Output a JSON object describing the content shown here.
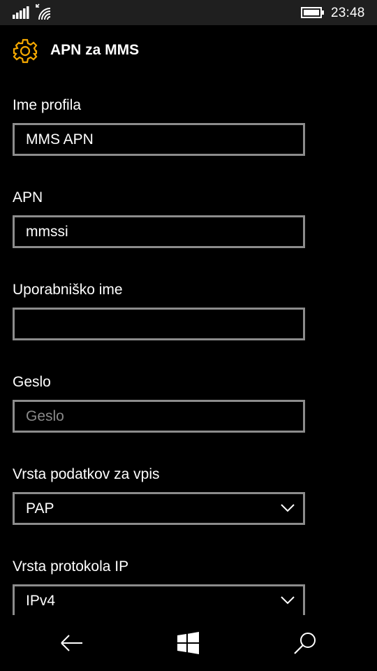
{
  "status_bar": {
    "time": "23:48",
    "icons": [
      "signal-icon",
      "wifi-icon",
      "battery-icon"
    ]
  },
  "header": {
    "title": "APN za MMS",
    "icon": "gear-icon",
    "accent": "#f5a800"
  },
  "form": {
    "profile_name": {
      "label": "Ime profila",
      "value": "MMS APN"
    },
    "apn": {
      "label": "APN",
      "value": "mmssi"
    },
    "username": {
      "label": "Uporabniško ime",
      "value": ""
    },
    "password": {
      "label": "Geslo",
      "placeholder": "Geslo",
      "value": ""
    },
    "auth_type": {
      "label": "Vrsta podatkov za vpis",
      "selected": "PAP"
    },
    "ip_type": {
      "label": "Vrsta protokola IP",
      "selected": "IPv4"
    }
  },
  "nav": {
    "icons": [
      "back-icon",
      "windows-icon",
      "search-icon"
    ]
  }
}
